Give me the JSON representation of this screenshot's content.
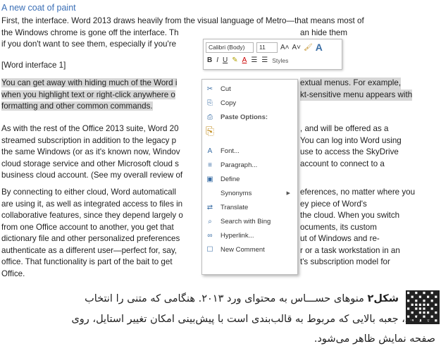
{
  "document": {
    "heading": "A new coat of paint",
    "paragraphs": [
      {
        "lines": [
          "First, the interface.  Word 2013 draws heavily from the visual language of Metro—that means most of",
          "the Windows chrome is gone off the interface. Th",
          "if you don't want to see them, especially if you're"
        ],
        "right_fragments": [
          "",
          "an hide them",
          ""
        ]
      },
      {
        "lines": [
          "[Word interface 1]"
        ]
      },
      {
        "lines": [
          "You can get away with hiding much of the Word i",
          "when you highlight text or right-click anywhere o",
          "formatting and other common commands."
        ],
        "right_fragments": [
          "extual menus. For example,",
          "kt-sensitive menu appears with",
          ""
        ]
      },
      {
        "lines": [
          "As with the rest of the Office 2013 suite, Word 20",
          "streamed subscription in addition to the legacy p",
          "the same Windows (or as it's known now, Windov",
          "cloud storage service and other Microsoft cloud s",
          "business cloud account. (See my overall review of"
        ],
        "right_fragments": [
          ", and will be offered as a",
          "You can log into Word using",
          "use to access the SkyDrive",
          "account to connect to a",
          ""
        ]
      },
      {
        "lines": [
          " By connecting to either cloud, Word automaticall",
          "are using it, as well as integrated access to files in",
          "collaborative features, since they depend largely o",
          "from one Office account to another, you get that",
          "dictionary file and other personalized preferences",
          "authenticate as a different user—perfect for, say,",
          "office. That functionality is part of the bait to get",
          "Office."
        ],
        "right_fragments": [
          "eferences, no matter where you",
          "ey piece of Word's",
          "the cloud. When you switch",
          "ocuments, its custom",
          "ut of Windows and re-",
          "r or a task workstation in an",
          "t's subscription model for",
          ""
        ]
      }
    ]
  },
  "mini_toolbar": {
    "font_name": "Calibri (Body)",
    "font_size": "11",
    "grow_label": "A˄",
    "shrink_label": "A˅",
    "bold": "B",
    "italic": "I",
    "underline": "U",
    "font_color_label": "A",
    "styles_label": "Styles"
  },
  "context_menu": {
    "items": [
      {
        "label": "Cut",
        "icon": "scissors-icon",
        "glyph": "✂"
      },
      {
        "label": "Copy",
        "icon": "copy-icon",
        "glyph": "⎘"
      },
      {
        "label": "Paste Options:",
        "icon": "paste-icon",
        "glyph": "⎙"
      },
      {
        "label": "",
        "icon": "clipboard-icon",
        "glyph": "⎘"
      },
      {
        "label": "Font...",
        "icon": "font-icon",
        "glyph": "A"
      },
      {
        "label": "Paragraph...",
        "icon": "paragraph-icon",
        "glyph": "≡"
      },
      {
        "label": "Define",
        "icon": "define-icon",
        "glyph": "▣"
      },
      {
        "label": "Synonyms",
        "icon": "",
        "glyph": ""
      },
      {
        "label": "Translate",
        "icon": "translate-icon",
        "glyph": "⇄"
      },
      {
        "label": "Search with Bing",
        "icon": "search-icon",
        "glyph": "⌕"
      },
      {
        "label": "Hyperlink...",
        "icon": "hyperlink-icon",
        "glyph": "∞"
      },
      {
        "label": "New Comment",
        "icon": "comment-icon",
        "glyph": "☐"
      }
    ],
    "submenu_arrow": "▶"
  },
  "caption": {
    "label": "شکل۲",
    "line1": "منوهای حســـاس به محتوای ورد ۲۰۱۳. هنگامی که متنی را انتخاب",
    "line2": "می‌کنید، جعبه بالایی که مربوط به قالب‌بندی است با پیش‌بینی امکان تغییر استایل، روی",
    "line3": "صفحه نمایش ظاهر می‌شود."
  },
  "colors": {
    "heading": "#3b6fb6",
    "selection": "#d7d7d7",
    "caption_bar": "#e4e4e4"
  }
}
